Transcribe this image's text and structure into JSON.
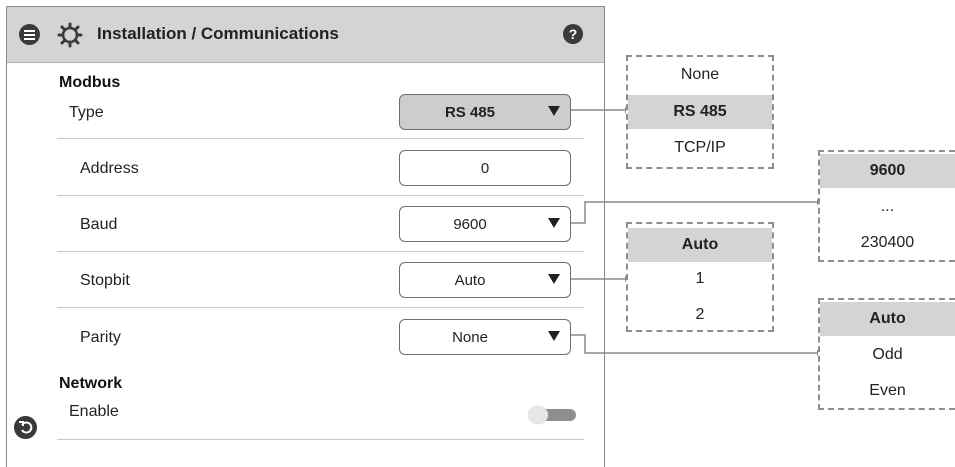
{
  "header": {
    "title": "Installation / Communications",
    "help_glyph": "?",
    "menu_icon": "hamburger-icon",
    "settings_icon": "gear-icon"
  },
  "modbus": {
    "section_title": "Modbus",
    "type": {
      "label": "Type",
      "value": "RS 485"
    },
    "address": {
      "label": "Address",
      "value": "0"
    },
    "baud": {
      "label": "Baud",
      "value": "9600"
    },
    "stopbit": {
      "label": "Stopbit",
      "value": "Auto"
    },
    "parity": {
      "label": "Parity",
      "value": "None"
    }
  },
  "network": {
    "section_title": "Network",
    "enable": {
      "label": "Enable",
      "enabled": false
    }
  },
  "dropdowns": {
    "type": {
      "options": [
        "None",
        "RS 485",
        "TCP/IP"
      ],
      "selected": "RS 485"
    },
    "baud": {
      "options": [
        "9600",
        "...",
        "230400"
      ],
      "selected": "9600"
    },
    "stopbit": {
      "options": [
        "Auto",
        "1",
        "2"
      ],
      "selected": "Auto"
    },
    "parity": {
      "options": [
        "Auto",
        "Odd",
        "Even"
      ],
      "selected": "Auto"
    }
  },
  "colors": {
    "header_bg": "#d4d4d4",
    "selected_bg": "#d4d4d4",
    "icon": "#3a3a3a",
    "connector": "#8a8a8a"
  }
}
